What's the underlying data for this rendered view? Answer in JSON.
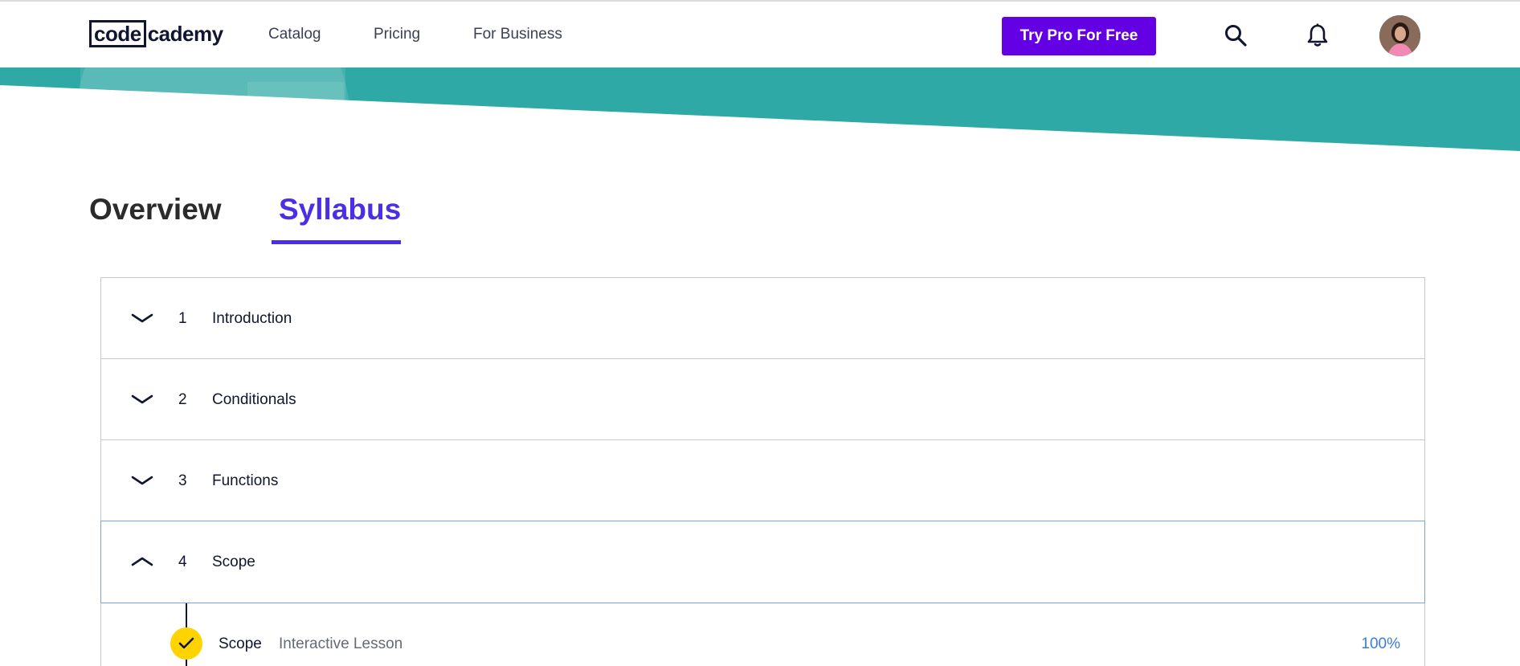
{
  "header": {
    "logo": {
      "part1": "code",
      "part2": "cademy"
    },
    "nav": [
      {
        "label": "Catalog"
      },
      {
        "label": "Pricing"
      },
      {
        "label": "For Business"
      }
    ],
    "cta_label": "Try Pro For Free",
    "icons": [
      "search-icon",
      "bell-icon",
      "avatar"
    ]
  },
  "colors": {
    "brand_purple": "#6400e4",
    "tab_active": "#4a2fe6",
    "banner_teal": "#2ea9a5",
    "check_yellow": "#ffd300",
    "progress_blue": "#3a7be0"
  },
  "tabs": [
    {
      "label": "Overview",
      "active": false
    },
    {
      "label": "Syllabus",
      "active": true
    }
  ],
  "syllabus": {
    "modules": [
      {
        "number": "1",
        "title": "Introduction",
        "expanded": false
      },
      {
        "number": "2",
        "title": "Conditionals",
        "expanded": false
      },
      {
        "number": "3",
        "title": "Functions",
        "expanded": false
      },
      {
        "number": "4",
        "title": "Scope",
        "expanded": true
      }
    ],
    "lessons": [
      {
        "title": "Scope",
        "type": "Interactive Lesson",
        "progress": "100%",
        "completed": true
      }
    ]
  }
}
